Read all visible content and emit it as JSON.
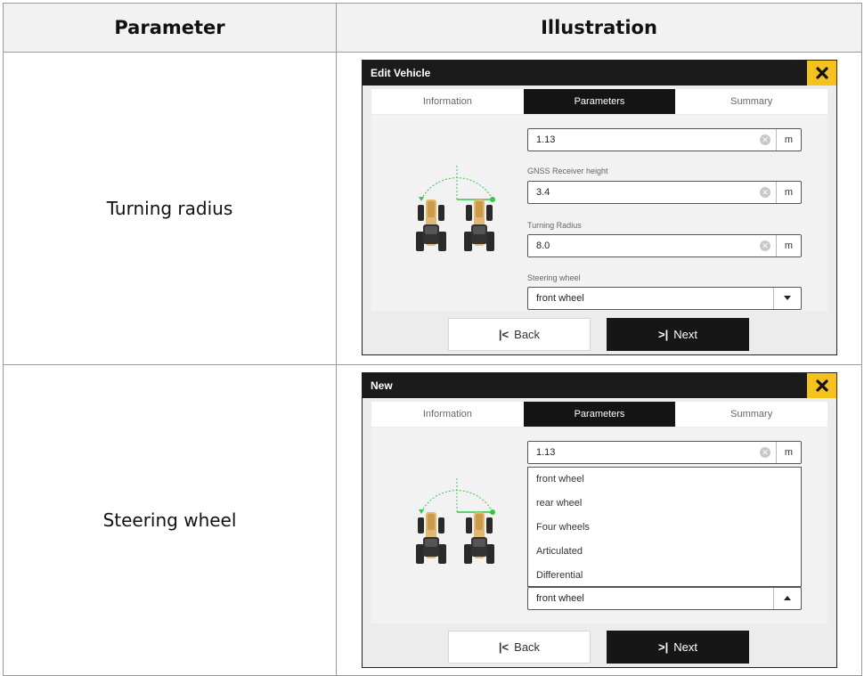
{
  "table": {
    "headers": [
      "Parameter",
      "Illustration"
    ],
    "rows": [
      {
        "parameter": "Turning radius",
        "screen": {
          "title": "Edit Vehicle",
          "tabs": [
            "Information",
            "Parameters",
            "Summary"
          ],
          "active_tab": "Parameters",
          "fields": [
            {
              "label": "",
              "value": "1.13",
              "unit": "m"
            },
            {
              "label": "GNSS Receiver height",
              "value": "3.4",
              "unit": "m"
            },
            {
              "label": "Turning Radius",
              "value": "8.0",
              "unit": "m"
            }
          ],
          "select": {
            "label": "Steering wheel",
            "value": "front wheel"
          },
          "back_label": "Back",
          "next_label": "Next"
        }
      },
      {
        "parameter": "Steering wheel",
        "screen": {
          "title": "New",
          "tabs": [
            "Information",
            "Parameters",
            "Summary"
          ],
          "active_tab": "Parameters",
          "fields": [
            {
              "label": "",
              "value": "1.13",
              "unit": "m"
            }
          ],
          "dropdown_options": [
            "front wheel",
            "rear wheel",
            "Four wheels",
            "Articulated",
            "Differential"
          ],
          "select": {
            "label": "",
            "value": "front wheel"
          },
          "back_label": "Back",
          "next_label": "Next"
        }
      }
    ]
  },
  "icons": {
    "close": "close-x-icon",
    "back": "back-to-start-icon",
    "next": "next-to-end-icon",
    "clear": "clear-circle-icon",
    "caret_down": "caret-down-icon",
    "caret_up": "caret-up-icon",
    "tractor": "tractor-turning-radius-diagram"
  },
  "colors": {
    "title_bar": "#1b1b1b",
    "close_button": "#f4c21c",
    "active_tab": "#141414",
    "turn_guide": "#2ec84a",
    "tractor_body": "#e0b870"
  }
}
